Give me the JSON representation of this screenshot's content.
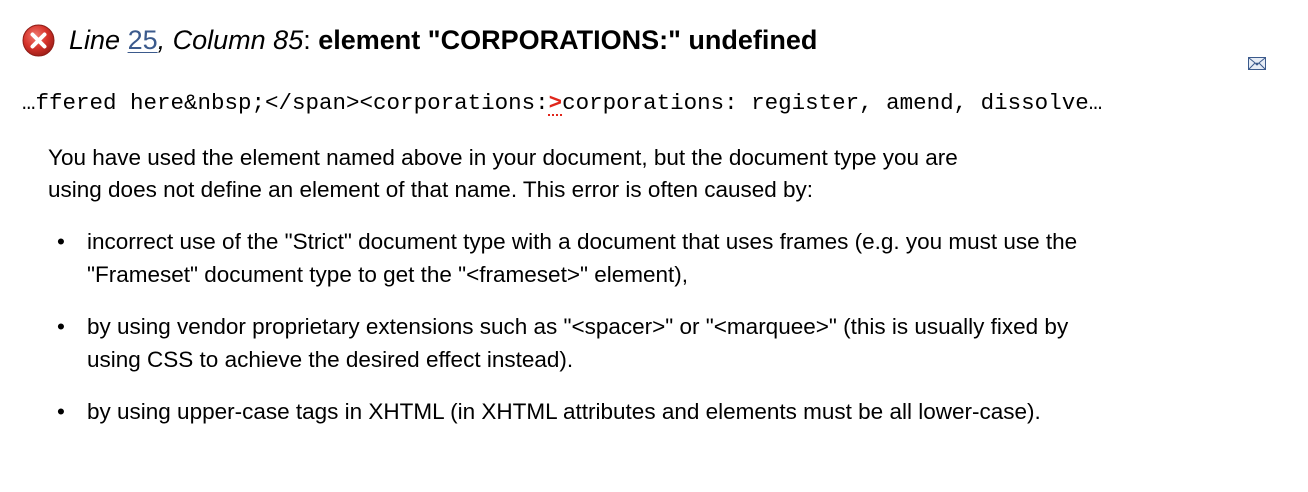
{
  "header": {
    "line_label": "Line",
    "line_number": "25",
    "separator": ",",
    "column_label": "Column 85",
    "colon": ":",
    "message": "element \"CORPORATIONS:\" undefined",
    "icon": "error-icon",
    "mini_icon": "envelope-icon"
  },
  "source": {
    "before": "…ffered here&nbsp;</span><corporations:",
    "marker": ">",
    "after": "corporations: register, amend, dissolve…"
  },
  "description": {
    "line1": "You have used the element named above in your document, but the document type you are",
    "line2": "using does not define an element of that name. This error is often caused by:"
  },
  "causes": [
    {
      "line1": "incorrect use of the \"Strict\" document type with a document that uses frames (e.g. you must use the",
      "line2": "\"Frameset\" document type to get the \"<frameset>\" element),"
    },
    {
      "line1": "by using vendor proprietary extensions such as \"<spacer>\" or \"<marquee>\" (this is usually fixed by",
      "line2": "using CSS to achieve the desired effect instead)."
    },
    {
      "line1": "by using upper-case tags in XHTML (in XHTML attributes and elements must be all lower-case).",
      "line2": ""
    }
  ],
  "bullet_char": "•",
  "colors": {
    "error_red": "#d6332b",
    "link_blue": "#3b5a8c",
    "marker_red": "#e0261b"
  }
}
